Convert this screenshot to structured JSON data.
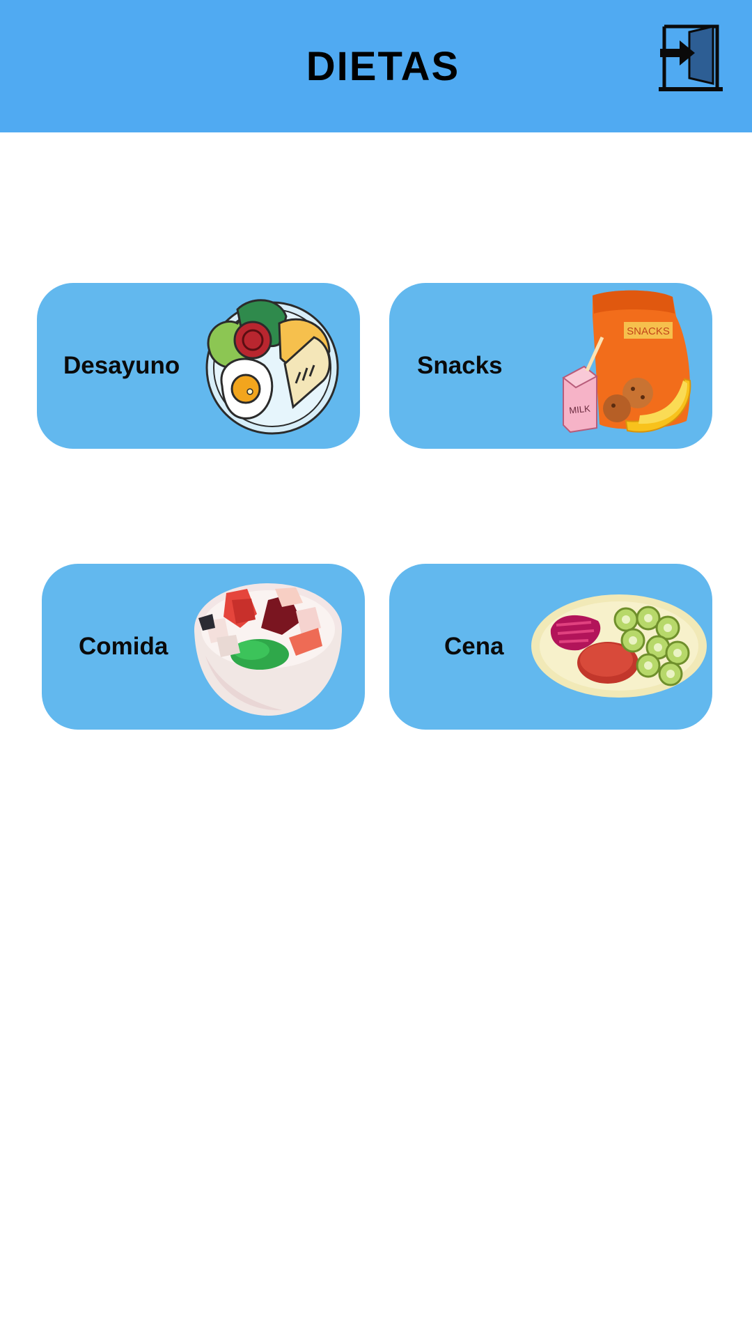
{
  "header": {
    "title": "DIETAS",
    "exit_icon": "exit-door-icon",
    "background": "#50aaf2"
  },
  "cards": [
    {
      "id": "desayuno",
      "label": "Desayuno",
      "icon": "breakfast-plate-icon"
    },
    {
      "id": "snacks",
      "label": "Snacks",
      "icon": "snacks-bag-icon"
    },
    {
      "id": "comida",
      "label": "Comida",
      "icon": "salad-bowl-icon"
    },
    {
      "id": "cena",
      "label": "Cena",
      "icon": "dinner-plate-icon"
    }
  ],
  "colors": {
    "card_background": "#62b8ee",
    "page_background": "#ffffff",
    "text": "#000000"
  }
}
